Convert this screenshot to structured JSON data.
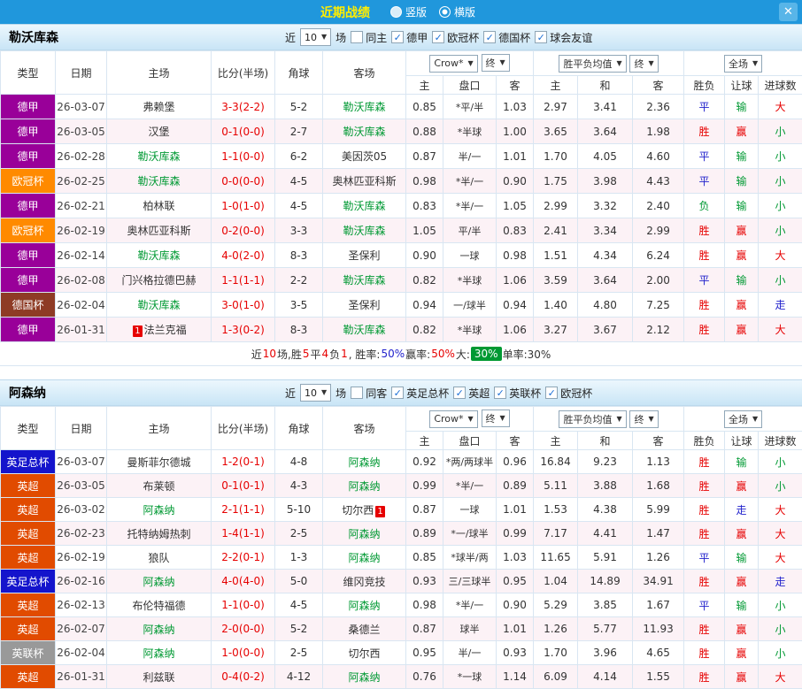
{
  "titlebar": {
    "title": "近期战绩",
    "radio_vertical": "竖版",
    "radio_horizontal": "横版",
    "close_icon": "✕"
  },
  "table_header": {
    "col_type": "类型",
    "col_date": "日期",
    "col_home": "主场",
    "col_score": "比分(半场)",
    "col_corner": "角球",
    "col_away": "客场",
    "dd_odds_source": "Crow*",
    "dd_final": "终",
    "dd_avg": "胜平负均值",
    "dd_fulltime": "全场",
    "sub": [
      "主",
      "盘口",
      "客",
      "主",
      "和",
      "客",
      "胜负",
      "让球",
      "进球数"
    ]
  },
  "sections": [
    {
      "team": "勒沃库森",
      "filter": {
        "near": "近",
        "count": "10",
        "games": "场",
        "same": "同主",
        "leagues": [
          "德甲",
          "欧冠杯",
          "德国杯",
          "球会友谊"
        ]
      },
      "rows": [
        {
          "league": "德甲",
          "league_bg": "#990099",
          "date": "26-03-07",
          "home": "弗赖堡",
          "away": "勒沃库森",
          "away_focus": true,
          "score": "3-3(2-2)",
          "corner": "5-2",
          "o1": "0.85",
          "pk": "*平/半",
          "o2": "1.03",
          "w": "2.97",
          "d": "3.41",
          "l": "2.36",
          "res": "平",
          "res_c": "b",
          "sp": "输",
          "sp_c": "g",
          "goal": "大",
          "goal_c": "r"
        },
        {
          "league": "德甲",
          "league_bg": "#990099",
          "date": "26-03-05",
          "home": "汉堡",
          "away": "勒沃库森",
          "away_focus": true,
          "score": "0-1(0-0)",
          "corner": "2-7",
          "o1": "0.88",
          "pk": "*半球",
          "o2": "1.00",
          "w": "3.65",
          "d": "3.64",
          "l": "1.98",
          "res": "胜",
          "res_c": "r",
          "sp": "赢",
          "sp_c": "r",
          "goal": "小",
          "goal_c": "g"
        },
        {
          "league": "德甲",
          "league_bg": "#990099",
          "date": "26-02-28",
          "home": "勒沃库森",
          "home_focus": true,
          "away": "美因茨05",
          "score": "1-1(0-0)",
          "corner": "6-2",
          "o1": "0.87",
          "pk": "半/一",
          "o2": "1.01",
          "w": "1.70",
          "d": "4.05",
          "l": "4.60",
          "res": "平",
          "res_c": "b",
          "sp": "输",
          "sp_c": "g",
          "goal": "小",
          "goal_c": "g"
        },
        {
          "league": "欧冠杯",
          "league_bg": "#ff8a00",
          "date": "26-02-25",
          "home": "勒沃库森",
          "home_focus": true,
          "away": "奥林匹亚科斯",
          "score": "0-0(0-0)",
          "corner": "4-5",
          "o1": "0.98",
          "pk": "*半/一",
          "o2": "0.90",
          "w": "1.75",
          "d": "3.98",
          "l": "4.43",
          "res": "平",
          "res_c": "b",
          "sp": "输",
          "sp_c": "g",
          "goal": "小",
          "goal_c": "g"
        },
        {
          "league": "德甲",
          "league_bg": "#990099",
          "date": "26-02-21",
          "home": "柏林联",
          "away": "勒沃库森",
          "away_focus": true,
          "score": "1-0(1-0)",
          "corner": "4-5",
          "o1": "0.83",
          "pk": "*半/一",
          "o2": "1.05",
          "w": "2.99",
          "d": "3.32",
          "l": "2.40",
          "res": "负",
          "res_c": "g",
          "sp": "输",
          "sp_c": "g",
          "goal": "小",
          "goal_c": "g"
        },
        {
          "league": "欧冠杯",
          "league_bg": "#ff8a00",
          "date": "26-02-19",
          "home": "奥林匹亚科斯",
          "away": "勒沃库森",
          "away_focus": true,
          "score": "0-2(0-0)",
          "corner": "3-3",
          "o1": "1.05",
          "pk": "平/半",
          "o2": "0.83",
          "w": "2.41",
          "d": "3.34",
          "l": "2.99",
          "res": "胜",
          "res_c": "r",
          "sp": "赢",
          "sp_c": "r",
          "goal": "小",
          "goal_c": "g"
        },
        {
          "league": "德甲",
          "league_bg": "#990099",
          "date": "26-02-14",
          "home": "勒沃库森",
          "home_focus": true,
          "away": "圣保利",
          "score": "4-0(2-0)",
          "corner": "8-3",
          "o1": "0.90",
          "pk": "一球",
          "o2": "0.98",
          "w": "1.51",
          "d": "4.34",
          "l": "6.24",
          "res": "胜",
          "res_c": "r",
          "sp": "赢",
          "sp_c": "r",
          "goal": "大",
          "goal_c": "r"
        },
        {
          "league": "德甲",
          "league_bg": "#990099",
          "date": "26-02-08",
          "home": "门兴格拉德巴赫",
          "away": "勒沃库森",
          "away_focus": true,
          "score": "1-1(1-1)",
          "corner": "2-2",
          "o1": "0.82",
          "pk": "*半球",
          "o2": "1.06",
          "w": "3.59",
          "d": "3.64",
          "l": "2.00",
          "res": "平",
          "res_c": "b",
          "sp": "输",
          "sp_c": "g",
          "goal": "小",
          "goal_c": "g"
        },
        {
          "league": "德国杯",
          "league_bg": "#8e3b25",
          "date": "26-02-04",
          "home": "勒沃库森",
          "home_focus": true,
          "away": "圣保利",
          "score": "3-0(1-0)",
          "corner": "3-5",
          "o1": "0.94",
          "pk": "一/球半",
          "o2": "0.94",
          "w": "1.40",
          "d": "4.80",
          "l": "7.25",
          "res": "胜",
          "res_c": "r",
          "sp": "赢",
          "sp_c": "r",
          "goal": "走",
          "goal_c": "b"
        },
        {
          "league": "德甲",
          "league_bg": "#990099",
          "date": "26-01-31",
          "home": "法兰克福",
          "home_card": "1",
          "away": "勒沃库森",
          "away_focus": true,
          "score": "1-3(0-2)",
          "corner": "8-3",
          "o1": "0.82",
          "pk": "*半球",
          "o2": "1.06",
          "w": "3.27",
          "d": "3.67",
          "l": "2.12",
          "res": "胜",
          "res_c": "r",
          "sp": "赢",
          "sp_c": "r",
          "goal": "大",
          "goal_c": "r"
        }
      ],
      "summary": [
        {
          "t": "近"
        },
        {
          "t": "10",
          "c": "#e60000"
        },
        {
          "t": "场,胜"
        },
        {
          "t": "5",
          "c": "#e60000"
        },
        {
          "t": "平"
        },
        {
          "t": "4",
          "c": "#e60000"
        },
        {
          "t": "负"
        },
        {
          "t": "1",
          "c": "#e60000"
        },
        {
          "t": ", 胜率:"
        },
        {
          "t": "50%",
          "c": "#2222cc"
        },
        {
          "t": " 赢率:"
        },
        {
          "t": "50%",
          "c": "#e60000"
        },
        {
          "t": " 大:"
        },
        {
          "t": "30%",
          "c": "#ffffff",
          "bg": "#009933"
        },
        {
          "t": " 单率:30%"
        }
      ]
    },
    {
      "team": "阿森纳",
      "filter": {
        "near": "近",
        "count": "10",
        "games": "场",
        "same": "同客",
        "leagues": [
          "英足总杯",
          "英超",
          "英联杯",
          "欧冠杯"
        ]
      },
      "rows": [
        {
          "league": "英足总杯",
          "league_bg": "#1414cc",
          "date": "26-03-07",
          "home": "曼斯菲尔德城",
          "away": "阿森纳",
          "away_focus": true,
          "score": "1-2(0-1)",
          "corner": "4-8",
          "o1": "0.92",
          "pk": "*两/两球半",
          "o2": "0.96",
          "w": "16.84",
          "d": "9.23",
          "l": "1.13",
          "res": "胜",
          "res_c": "r",
          "sp": "输",
          "sp_c": "g",
          "goal": "小",
          "goal_c": "g"
        },
        {
          "league": "英超",
          "league_bg": "#e14b00",
          "date": "26-03-05",
          "home": "布莱顿",
          "away": "阿森纳",
          "away_focus": true,
          "score": "0-1(0-1)",
          "corner": "4-3",
          "o1": "0.99",
          "pk": "*半/一",
          "o2": "0.89",
          "w": "5.11",
          "d": "3.88",
          "l": "1.68",
          "res": "胜",
          "res_c": "r",
          "sp": "赢",
          "sp_c": "r",
          "goal": "小",
          "goal_c": "g"
        },
        {
          "league": "英超",
          "league_bg": "#e14b00",
          "date": "26-03-02",
          "home": "阿森纳",
          "home_focus": true,
          "away": "切尔西",
          "away_card": "1",
          "score": "2-1(1-1)",
          "corner": "5-10",
          "o1": "0.87",
          "pk": "一球",
          "o2": "1.01",
          "w": "1.53",
          "d": "4.38",
          "l": "5.99",
          "res": "胜",
          "res_c": "r",
          "sp": "走",
          "sp_c": "b",
          "goal": "大",
          "goal_c": "r"
        },
        {
          "league": "英超",
          "league_bg": "#e14b00",
          "date": "26-02-23",
          "home": "托特纳姆热刺",
          "away": "阿森纳",
          "away_focus": true,
          "score": "1-4(1-1)",
          "corner": "2-5",
          "o1": "0.89",
          "pk": "*一/球半",
          "o2": "0.99",
          "w": "7.17",
          "d": "4.41",
          "l": "1.47",
          "res": "胜",
          "res_c": "r",
          "sp": "赢",
          "sp_c": "r",
          "goal": "大",
          "goal_c": "r"
        },
        {
          "league": "英超",
          "league_bg": "#e14b00",
          "date": "26-02-19",
          "home": "狼队",
          "away": "阿森纳",
          "away_focus": true,
          "score": "2-2(0-1)",
          "corner": "1-3",
          "o1": "0.85",
          "pk": "*球半/两",
          "o2": "1.03",
          "w": "11.65",
          "d": "5.91",
          "l": "1.26",
          "res": "平",
          "res_c": "b",
          "sp": "输",
          "sp_c": "g",
          "goal": "大",
          "goal_c": "r"
        },
        {
          "league": "英足总杯",
          "league_bg": "#1414cc",
          "date": "26-02-16",
          "home": "阿森纳",
          "home_focus": true,
          "away": "维冈竞技",
          "score": "4-0(4-0)",
          "corner": "5-0",
          "o1": "0.93",
          "pk": "三/三球半",
          "o2": "0.95",
          "w": "1.04",
          "d": "14.89",
          "l": "34.91",
          "res": "胜",
          "res_c": "r",
          "sp": "赢",
          "sp_c": "r",
          "goal": "走",
          "goal_c": "b"
        },
        {
          "league": "英超",
          "league_bg": "#e14b00",
          "date": "26-02-13",
          "home": "布伦特福德",
          "away": "阿森纳",
          "away_focus": true,
          "score": "1-1(0-0)",
          "corner": "4-5",
          "o1": "0.98",
          "pk": "*半/一",
          "o2": "0.90",
          "w": "5.29",
          "d": "3.85",
          "l": "1.67",
          "res": "平",
          "res_c": "b",
          "sp": "输",
          "sp_c": "g",
          "goal": "小",
          "goal_c": "g"
        },
        {
          "league": "英超",
          "league_bg": "#e14b00",
          "date": "26-02-07",
          "home": "阿森纳",
          "home_focus": true,
          "away": "桑德兰",
          "score": "2-0(0-0)",
          "corner": "5-2",
          "o1": "0.87",
          "pk": "球半",
          "o2": "1.01",
          "w": "1.26",
          "d": "5.77",
          "l": "11.93",
          "res": "胜",
          "res_c": "r",
          "sp": "赢",
          "sp_c": "r",
          "goal": "小",
          "goal_c": "g"
        },
        {
          "league": "英联杯",
          "league_bg": "#999999",
          "date": "26-02-04",
          "home": "阿森纳",
          "home_focus": true,
          "away": "切尔西",
          "score": "1-0(0-0)",
          "corner": "2-5",
          "o1": "0.95",
          "pk": "半/一",
          "o2": "0.93",
          "w": "1.70",
          "d": "3.96",
          "l": "4.65",
          "res": "胜",
          "res_c": "r",
          "sp": "赢",
          "sp_c": "r",
          "goal": "小",
          "goal_c": "g"
        },
        {
          "league": "英超",
          "league_bg": "#e14b00",
          "date": "26-01-31",
          "home": "利兹联",
          "away": "阿森纳",
          "away_focus": true,
          "score": "0-4(0-2)",
          "corner": "4-12",
          "o1": "0.76",
          "pk": "*一球",
          "o2": "1.14",
          "w": "6.09",
          "d": "4.14",
          "l": "1.55",
          "res": "胜",
          "res_c": "r",
          "sp": "赢",
          "sp_c": "r",
          "goal": "大",
          "goal_c": "r"
        }
      ]
    }
  ]
}
